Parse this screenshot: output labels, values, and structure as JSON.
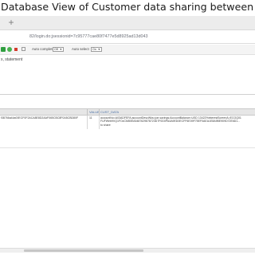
{
  "caption": "Database View of Customer data sharing between Party A ( Bank) and",
  "browser": {
    "new_tab_symbol": "+",
    "url": "82/login.do;jsessionid=7c95777cae80f7477e5d8925ad13d043"
  },
  "toolbar": {
    "autocomplete_label": "Auto complete",
    "autocomplete_value": "Off",
    "autoselect_label": "Auto select",
    "autoselect_value": "On"
  },
  "editor": {
    "text": "x, statement"
  },
  "results": {
    "columns": [
      "VALUE",
      "CUST_DATA"
    ],
    "row": {
      "key": "f38766a44a00ECF0F2ACA8E8D2AAF065CBC8F0A5CBD80F",
      "value": "11",
      "cust_data_line1": "accountNo=A03ADFEFA;accountDescWks=joe.savings;AccountBalance=USD 13422%interestScreenA=ECOQ01",
      "cust_data_line2": "FUFWeb9VQ1FOzCM80EA5487629878723D7F0D0PA4A9ED0ECFF6E09F75EF0AEA1E8A9BE909D72E6D1...",
      "cust_data_line3": "to share"
    }
  },
  "icons": {
    "run": "run-icon",
    "run_selected": "run-selected-icon",
    "stop": "stop-icon",
    "clear": "clear-icon"
  }
}
